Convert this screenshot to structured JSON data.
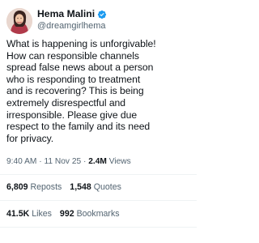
{
  "author": {
    "display_name": "Hema Malini",
    "handle": "@dreamgirlhema",
    "verified_icon": "verified-badge-icon",
    "verified_color": "#1d9bf0"
  },
  "tweet": {
    "lines": [
      "What is happening is unforgivable!",
      "How can responsible channels",
      "spread false news about a person",
      "who is responding to treatment",
      "and is recovering? This is being",
      "extremely disrespectful and",
      "irresponsible. Please give due",
      "respect to the family and its need",
      "for privacy."
    ]
  },
  "meta": {
    "time": "9:40 AM",
    "separator": "·",
    "date": "11 Nov 25",
    "views_count": "2.4M",
    "views_label": "Views"
  },
  "stats": {
    "reposts": {
      "value": "6,809",
      "label": "Reposts"
    },
    "quotes": {
      "value": "1,548",
      "label": "Quotes"
    },
    "likes": {
      "value": "41.5K",
      "label": "Likes"
    },
    "bookmarks": {
      "value": "992",
      "label": "Bookmarks"
    }
  },
  "colors": {
    "text_primary": "#0f1419",
    "text_secondary": "#536471",
    "divider": "#eff3f4"
  }
}
